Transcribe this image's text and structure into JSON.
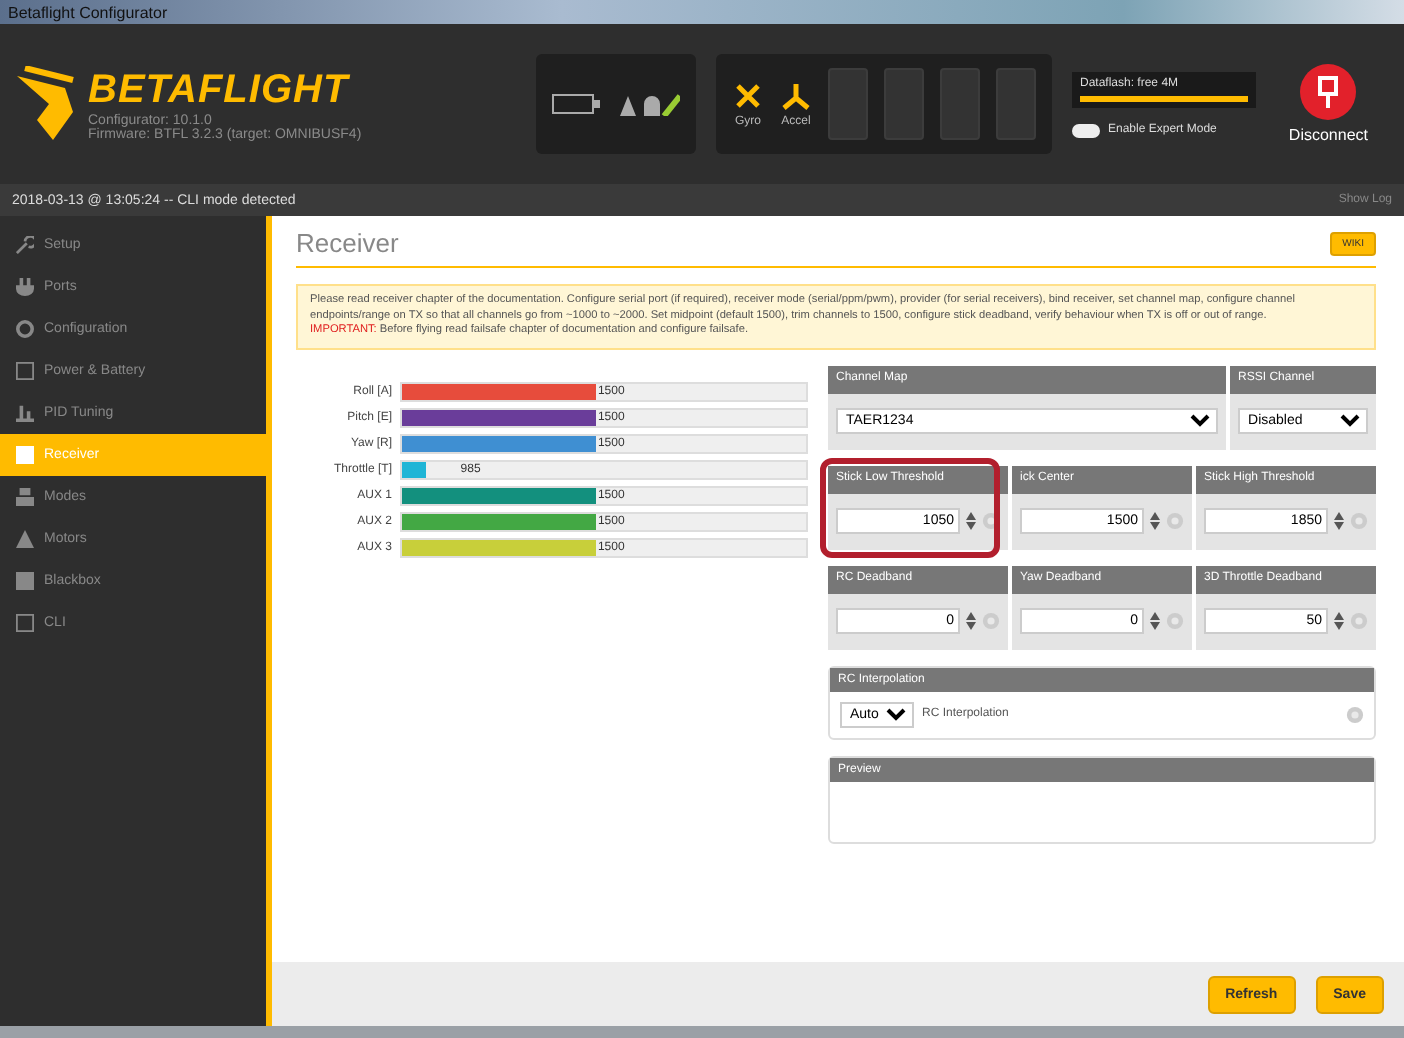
{
  "window": {
    "title": "Betaflight Configurator"
  },
  "header": {
    "logo": "BETAFLIGHT",
    "version": "Configurator: 10.1.0",
    "firmware": "Firmware: BTFL 3.2.3 (target: OMNIBUSF4)",
    "sensors": [
      {
        "label": "Gyro",
        "on": true
      },
      {
        "label": "Accel",
        "on": true
      }
    ],
    "dataflash": "Dataflash: free 4M",
    "expert_mode": {
      "label": "Enable Expert Mode",
      "on": false
    },
    "disconnect": "Disconnect"
  },
  "status_line": {
    "text": "2018-03-13 @ 13:05:24 -- CLI mode detected",
    "show_log": "Show Log"
  },
  "sidebar": {
    "items": [
      {
        "label": "Setup",
        "selected": false
      },
      {
        "label": "Ports",
        "selected": false
      },
      {
        "label": "Configuration",
        "selected": false
      },
      {
        "label": "Power & Battery",
        "selected": false
      },
      {
        "label": "PID Tuning",
        "selected": false
      },
      {
        "label": "Receiver",
        "selected": true
      },
      {
        "label": "Modes",
        "selected": false
      },
      {
        "label": "Motors",
        "selected": false
      },
      {
        "label": "Blackbox",
        "selected": false
      },
      {
        "label": "CLI",
        "selected": false
      }
    ]
  },
  "page": {
    "title": "Receiver",
    "wiki": "WIKI",
    "note": "Please read receiver chapter of the documentation. Configure serial port (if required), receiver mode (serial/ppm/pwm), provider (for serial receivers), bind receiver, set channel map, configure channel endpoints/range on TX so that all channels go from ~1000 to ~2000. Set midpoint (default 1500), trim channels to 1500, configure stick deadband, verify behaviour when TX is off or out of range.",
    "important_label": "IMPORTANT:",
    "important": "Before flying read failsafe chapter of documentation and configure failsafe.",
    "channels": [
      {
        "name": "Roll [A]",
        "value": "1500",
        "level": 0.48,
        "color": "#e74c3c"
      },
      {
        "name": "Pitch [E]",
        "value": "1500",
        "level": 0.48,
        "color": "#6a3d9a"
      },
      {
        "name": "Yaw [R]",
        "value": "1500",
        "level": 0.48,
        "color": "#3f8fd2"
      },
      {
        "name": "Throttle [T]",
        "value": "985",
        "level": 0.06,
        "color": "#1fb5d6"
      },
      {
        "name": "AUX 1",
        "value": "1500",
        "level": 0.48,
        "color": "#13907e"
      },
      {
        "name": "AUX 2",
        "value": "1500",
        "level": 0.48,
        "color": "#43a844"
      },
      {
        "name": "AUX 3",
        "value": "1500",
        "level": 0.48,
        "color": "#c8cf3a"
      }
    ],
    "channel_map": {
      "label": "Channel Map",
      "value": "TAER1234"
    },
    "rssi": {
      "label": "RSSI Channel",
      "value": "Disabled"
    },
    "thresholds": [
      {
        "label": "Stick Low Threshold",
        "value": "1050",
        "highlighted": true
      },
      {
        "label": "ick Center",
        "value": "1500",
        "highlighted": false
      },
      {
        "label": "Stick High Threshold",
        "value": "1850",
        "highlighted": false
      }
    ],
    "deadbands": [
      {
        "label": "RC Deadband",
        "value": "0"
      },
      {
        "label": "Yaw Deadband",
        "value": "0"
      },
      {
        "label": "3D Throttle Deadband",
        "value": "50"
      }
    ],
    "interpolation": {
      "title": "RC Interpolation",
      "value": "Auto",
      "label": "RC Interpolation"
    },
    "preview": {
      "title": "Preview"
    },
    "buttons": [
      "Refresh",
      "Save"
    ]
  }
}
